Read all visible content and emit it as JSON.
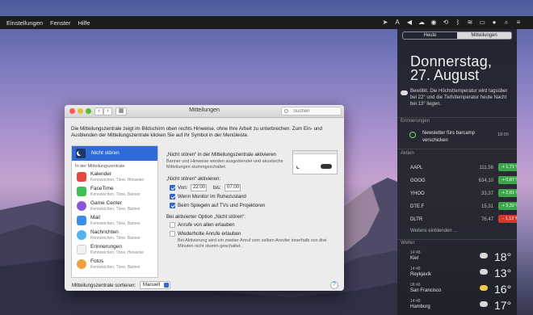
{
  "menubar": {
    "items": [
      "Einstellungen",
      "Fenster",
      "Hilfe"
    ]
  },
  "notification_center": {
    "tabs": {
      "today": "Heute",
      "notifications": "Mitteilungen"
    },
    "day": "Donnerstag,",
    "date": "27. August",
    "weather_summary": "Bewölkt. Die Höchsttemperatur wird tagsüber bei 22° und die Tiefsttemperatur heute Nacht bei 13° liegen.",
    "reminders": {
      "heading": "Erinnerungen",
      "title": "Newsletter fürs barcamp verschicken",
      "time": "18:00"
    },
    "stocks": {
      "heading": "Aktien",
      "rows": [
        {
          "symbol": "AAPL",
          "price": "111,56",
          "change": "+ 1,71 %",
          "color": "#3aa84a"
        },
        {
          "symbol": "GOOG",
          "price": "634,10",
          "change": "+ 0,87 %",
          "color": "#3aa84a"
        },
        {
          "symbol": "YHOO",
          "price": "33,37",
          "change": "+ 2,81 %",
          "color": "#3aa84a"
        },
        {
          "symbol": "DTE.F",
          "price": "15,31",
          "change": "+ 3,32 %",
          "color": "#3aa84a"
        },
        {
          "symbol": "DLTR",
          "price": "76,47",
          "change": "- 1,12 %",
          "color": "#d9342b"
        }
      ],
      "more": "Weitere einblenden ..."
    },
    "weather": {
      "heading": "Wetter",
      "rows": [
        {
          "time": "14:48",
          "city": "Kiel",
          "temp": "18°"
        },
        {
          "time": "14:48",
          "city": "Reykjavík",
          "temp": "13°"
        },
        {
          "time": "08:48",
          "city": "San Francisco",
          "temp": "16°"
        },
        {
          "time": "14:48",
          "city": "Hamburg",
          "temp": "17°"
        }
      ]
    }
  },
  "window": {
    "title": "Mitteilungen",
    "search_placeholder": "Suchen",
    "description": "Die Mitteilungszentrale zeigt im Bildschirm oben rechts Hinweise, ohne Ihre Arbeit zu unterbrechen. Zum Ein- und Ausblenden der Mitteilungszentrale klicken Sie auf ihr Symbol in der Menüleiste.",
    "dnd_item": "Nicht stören",
    "section_header": "In der Mitteilungszentrale",
    "apps": [
      {
        "name": "Kalender",
        "sub": "Kennzeichen, Töne, Hinweise",
        "color": "#e8473e"
      },
      {
        "name": "FaceTime",
        "sub": "Kennzeichen, Töne, Banner",
        "color": "#3cc053"
      },
      {
        "name": "Game Center",
        "sub": "Kennzeichen, Töne, Banner",
        "color": "#8a57d8"
      },
      {
        "name": "Mail",
        "sub": "Kennzeichen, Töne, Banner",
        "color": "#3b8ee6"
      },
      {
        "name": "Nachrichten",
        "sub": "Kennzeichen, Töne, Banner",
        "color": "#4fb3f2"
      },
      {
        "name": "Erinnerungen",
        "sub": "Kennzeichen, Töne, Hinweise",
        "color": "#f2f2f2"
      },
      {
        "name": "Fotos",
        "sub": "Kennzeichen, Töne, Banner",
        "color": "#f0a23a"
      }
    ],
    "detail": {
      "heading": "„Nicht stören“ in der Mitteilungszentrale aktivieren",
      "heading_sub": "Banner und Hinweise werden ausgeblendet und akustische Mitteilungen stummgeschaltet.",
      "enable_label": "„Nicht stören“ aktivieren:",
      "from_label": "Von:",
      "from_value": "22:00",
      "to_label": "bis:",
      "to_value": "07:00",
      "monitor_label": "Wenn Monitor im Ruhezustand",
      "mirror_label": "Beim Spiegeln auf TVs und Projektoren",
      "active_label": "Bei aktivierter Option „Nicht stören“:",
      "allow_calls_label": "Anrufe von allen erlauben",
      "repeat_calls_label": "Wiederholte Anrufe erlauben",
      "repeat_calls_sub": "Bei Aktivierung wird ein zweiter Anruf vom selben Anrufer innerhalb von drei Minuten nicht stumm geschaltet."
    },
    "sort_label": "Mitteilungszentrale sortieren:",
    "sort_value": "Manuell",
    "help": "?"
  },
  "colors": {
    "accent": "#2f6bd6",
    "close": "#fc5b57",
    "minimize": "#e5bf3c",
    "zoom": "#57c038"
  }
}
